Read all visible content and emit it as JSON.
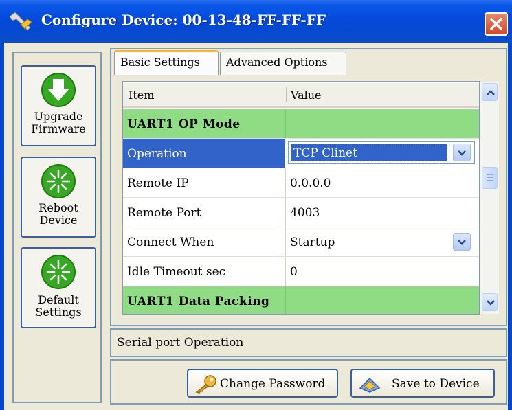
{
  "window": {
    "title": "Configure Device: 00-13-48-FF-FF-FF",
    "title_icon": "wrench-screwdriver-icon",
    "close_icon": "close-x-icon"
  },
  "sidebar": {
    "buttons": [
      {
        "icon": "download-arrow-icon",
        "line1": "Upgrade",
        "line2": "Firmware"
      },
      {
        "icon": "burst-icon",
        "line1": "Reboot",
        "line2": "Device"
      },
      {
        "icon": "burst-icon",
        "line1": "Default",
        "line2": "Settings"
      }
    ]
  },
  "tabs": [
    {
      "label": "Basic Settings",
      "active": true
    },
    {
      "label": "Advanced Options",
      "active": false
    }
  ],
  "grid": {
    "columns": [
      "Item",
      "Value"
    ],
    "rows": [
      {
        "item": "UART1 OP Mode",
        "value": "",
        "type": "group"
      },
      {
        "item": "Operation",
        "value": "TCP Clinet",
        "type": "dropdown-selected"
      },
      {
        "item": "Remote IP",
        "value": "0.0.0.0",
        "type": "text"
      },
      {
        "item": "Remote Port",
        "value": "4003",
        "type": "text"
      },
      {
        "item": "Connect When",
        "value": "Startup",
        "type": "dropdown"
      },
      {
        "item": "Idle Timeout sec",
        "value": "0",
        "type": "text"
      },
      {
        "item": "UART1 Data Packing",
        "value": "",
        "type": "group"
      }
    ]
  },
  "description": "Serial port Operation",
  "actions": {
    "change_password": "Change Password",
    "save_to_device": "Save to Device",
    "change_password_icon": "key-icon",
    "save_icon": "save-device-icon"
  },
  "colors": {
    "titlebar": "#0347d7",
    "group_row": "#8fdc85",
    "selection": "#3163c8",
    "tab_highlight": "#f8b53c",
    "sidebar_icon_green": "#36a823"
  }
}
